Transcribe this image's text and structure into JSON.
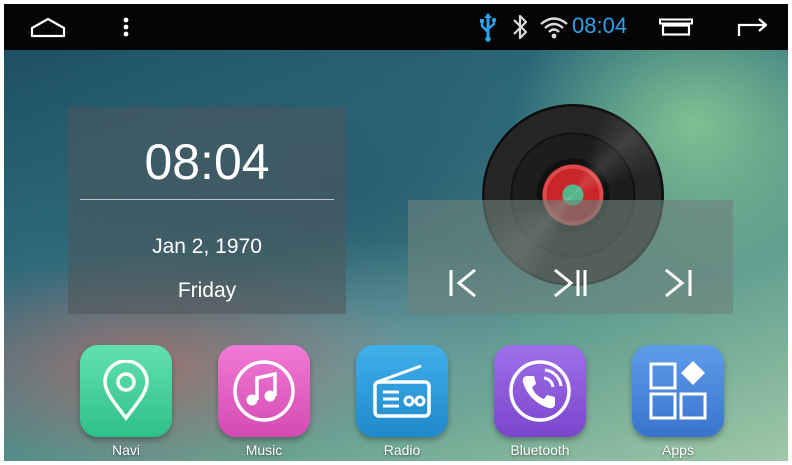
{
  "status_bar": {
    "time": "08:04",
    "time_color": "#29a3f0",
    "icons": [
      "home-icon",
      "menu-dots-icon",
      "usb-icon",
      "bluetooth-icon",
      "wifi-icon",
      "recent-apps-icon",
      "back-icon"
    ]
  },
  "clock_widget": {
    "time": "08:04",
    "date": "Jan 2, 1970",
    "day": "Friday"
  },
  "music_widget": {
    "disc_colors": {
      "label": "#c9262b",
      "center": "#52b788"
    },
    "controls": [
      "previous-icon",
      "play-pause-icon",
      "next-icon"
    ]
  },
  "dock": {
    "apps": [
      {
        "label": "Navi",
        "icon": "location-pin-icon",
        "color": "#3fcf9a"
      },
      {
        "label": "Music",
        "icon": "music-note-icon",
        "color": "#e05cc0"
      },
      {
        "label": "Radio",
        "icon": "radio-icon",
        "color": "#2a9ad8"
      },
      {
        "label": "Bluetooth",
        "icon": "phone-call-icon",
        "color": "#8a5ad8"
      },
      {
        "label": "Apps",
        "icon": "apps-grid-icon",
        "color": "#4a86d8"
      }
    ]
  }
}
